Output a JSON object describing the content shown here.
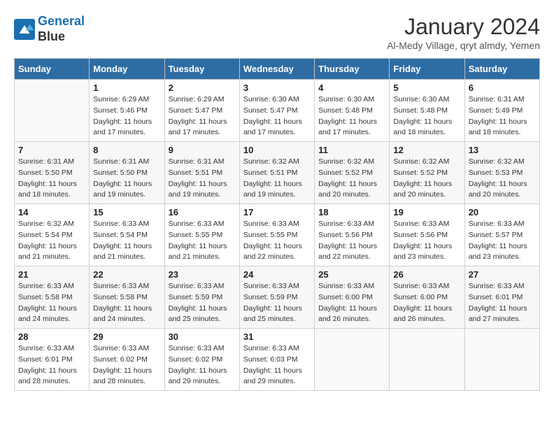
{
  "header": {
    "logo_line1": "General",
    "logo_line2": "Blue",
    "month": "January 2024",
    "location": "Al-Medy Village, qryt almdy, Yemen"
  },
  "weekdays": [
    "Sunday",
    "Monday",
    "Tuesday",
    "Wednesday",
    "Thursday",
    "Friday",
    "Saturday"
  ],
  "weeks": [
    [
      {
        "day": "",
        "sunrise": "",
        "sunset": "",
        "daylight": ""
      },
      {
        "day": "1",
        "sunrise": "Sunrise: 6:29 AM",
        "sunset": "Sunset: 5:46 PM",
        "daylight": "Daylight: 11 hours and 17 minutes."
      },
      {
        "day": "2",
        "sunrise": "Sunrise: 6:29 AM",
        "sunset": "Sunset: 5:47 PM",
        "daylight": "Daylight: 11 hours and 17 minutes."
      },
      {
        "day": "3",
        "sunrise": "Sunrise: 6:30 AM",
        "sunset": "Sunset: 5:47 PM",
        "daylight": "Daylight: 11 hours and 17 minutes."
      },
      {
        "day": "4",
        "sunrise": "Sunrise: 6:30 AM",
        "sunset": "Sunset: 5:48 PM",
        "daylight": "Daylight: 11 hours and 17 minutes."
      },
      {
        "day": "5",
        "sunrise": "Sunrise: 6:30 AM",
        "sunset": "Sunset: 5:48 PM",
        "daylight": "Daylight: 11 hours and 18 minutes."
      },
      {
        "day": "6",
        "sunrise": "Sunrise: 6:31 AM",
        "sunset": "Sunset: 5:49 PM",
        "daylight": "Daylight: 11 hours and 18 minutes."
      }
    ],
    [
      {
        "day": "7",
        "sunrise": "Sunrise: 6:31 AM",
        "sunset": "Sunset: 5:50 PM",
        "daylight": "Daylight: 11 hours and 18 minutes."
      },
      {
        "day": "8",
        "sunrise": "Sunrise: 6:31 AM",
        "sunset": "Sunset: 5:50 PM",
        "daylight": "Daylight: 11 hours and 19 minutes."
      },
      {
        "day": "9",
        "sunrise": "Sunrise: 6:31 AM",
        "sunset": "Sunset: 5:51 PM",
        "daylight": "Daylight: 11 hours and 19 minutes."
      },
      {
        "day": "10",
        "sunrise": "Sunrise: 6:32 AM",
        "sunset": "Sunset: 5:51 PM",
        "daylight": "Daylight: 11 hours and 19 minutes."
      },
      {
        "day": "11",
        "sunrise": "Sunrise: 6:32 AM",
        "sunset": "Sunset: 5:52 PM",
        "daylight": "Daylight: 11 hours and 20 minutes."
      },
      {
        "day": "12",
        "sunrise": "Sunrise: 6:32 AM",
        "sunset": "Sunset: 5:52 PM",
        "daylight": "Daylight: 11 hours and 20 minutes."
      },
      {
        "day": "13",
        "sunrise": "Sunrise: 6:32 AM",
        "sunset": "Sunset: 5:53 PM",
        "daylight": "Daylight: 11 hours and 20 minutes."
      }
    ],
    [
      {
        "day": "14",
        "sunrise": "Sunrise: 6:32 AM",
        "sunset": "Sunset: 5:54 PM",
        "daylight": "Daylight: 11 hours and 21 minutes."
      },
      {
        "day": "15",
        "sunrise": "Sunrise: 6:33 AM",
        "sunset": "Sunset: 5:54 PM",
        "daylight": "Daylight: 11 hours and 21 minutes."
      },
      {
        "day": "16",
        "sunrise": "Sunrise: 6:33 AM",
        "sunset": "Sunset: 5:55 PM",
        "daylight": "Daylight: 11 hours and 21 minutes."
      },
      {
        "day": "17",
        "sunrise": "Sunrise: 6:33 AM",
        "sunset": "Sunset: 5:55 PM",
        "daylight": "Daylight: 11 hours and 22 minutes."
      },
      {
        "day": "18",
        "sunrise": "Sunrise: 6:33 AM",
        "sunset": "Sunset: 5:56 PM",
        "daylight": "Daylight: 11 hours and 22 minutes."
      },
      {
        "day": "19",
        "sunrise": "Sunrise: 6:33 AM",
        "sunset": "Sunset: 5:56 PM",
        "daylight": "Daylight: 11 hours and 23 minutes."
      },
      {
        "day": "20",
        "sunrise": "Sunrise: 6:33 AM",
        "sunset": "Sunset: 5:57 PM",
        "daylight": "Daylight: 11 hours and 23 minutes."
      }
    ],
    [
      {
        "day": "21",
        "sunrise": "Sunrise: 6:33 AM",
        "sunset": "Sunset: 5:58 PM",
        "daylight": "Daylight: 11 hours and 24 minutes."
      },
      {
        "day": "22",
        "sunrise": "Sunrise: 6:33 AM",
        "sunset": "Sunset: 5:58 PM",
        "daylight": "Daylight: 11 hours and 24 minutes."
      },
      {
        "day": "23",
        "sunrise": "Sunrise: 6:33 AM",
        "sunset": "Sunset: 5:59 PM",
        "daylight": "Daylight: 11 hours and 25 minutes."
      },
      {
        "day": "24",
        "sunrise": "Sunrise: 6:33 AM",
        "sunset": "Sunset: 5:59 PM",
        "daylight": "Daylight: 11 hours and 25 minutes."
      },
      {
        "day": "25",
        "sunrise": "Sunrise: 6:33 AM",
        "sunset": "Sunset: 6:00 PM",
        "daylight": "Daylight: 11 hours and 26 minutes."
      },
      {
        "day": "26",
        "sunrise": "Sunrise: 6:33 AM",
        "sunset": "Sunset: 6:00 PM",
        "daylight": "Daylight: 11 hours and 26 minutes."
      },
      {
        "day": "27",
        "sunrise": "Sunrise: 6:33 AM",
        "sunset": "Sunset: 6:01 PM",
        "daylight": "Daylight: 11 hours and 27 minutes."
      }
    ],
    [
      {
        "day": "28",
        "sunrise": "Sunrise: 6:33 AM",
        "sunset": "Sunset: 6:01 PM",
        "daylight": "Daylight: 11 hours and 28 minutes."
      },
      {
        "day": "29",
        "sunrise": "Sunrise: 6:33 AM",
        "sunset": "Sunset: 6:02 PM",
        "daylight": "Daylight: 11 hours and 28 minutes."
      },
      {
        "day": "30",
        "sunrise": "Sunrise: 6:33 AM",
        "sunset": "Sunset: 6:02 PM",
        "daylight": "Daylight: 11 hours and 29 minutes."
      },
      {
        "day": "31",
        "sunrise": "Sunrise: 6:33 AM",
        "sunset": "Sunset: 6:03 PM",
        "daylight": "Daylight: 11 hours and 29 minutes."
      },
      {
        "day": "",
        "sunrise": "",
        "sunset": "",
        "daylight": ""
      },
      {
        "day": "",
        "sunrise": "",
        "sunset": "",
        "daylight": ""
      },
      {
        "day": "",
        "sunrise": "",
        "sunset": "",
        "daylight": ""
      }
    ]
  ]
}
